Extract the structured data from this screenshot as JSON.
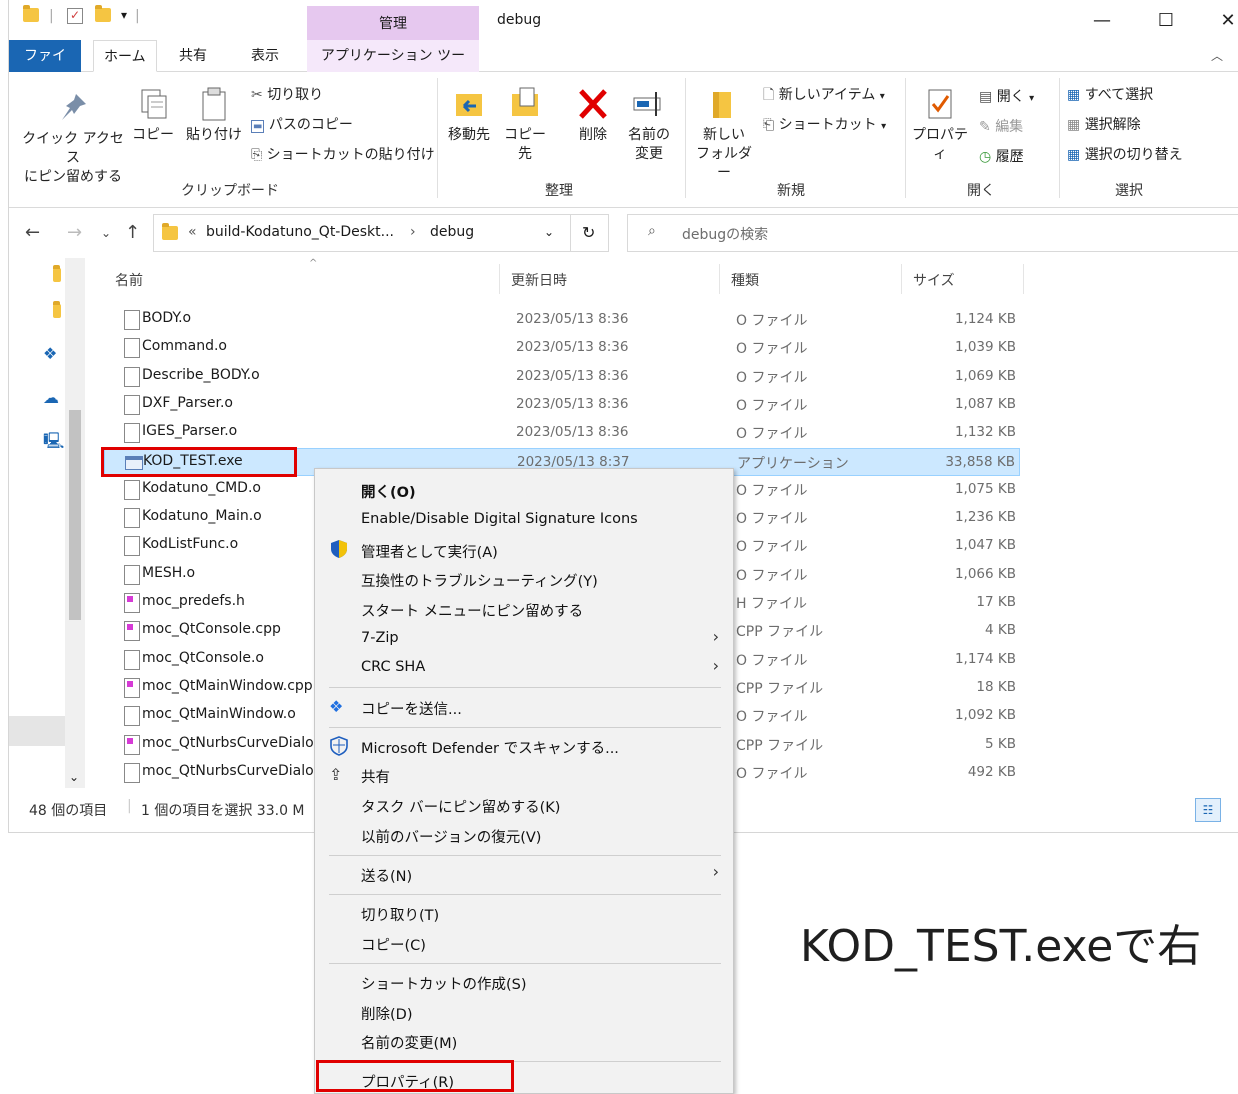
{
  "window": {
    "title": "debug",
    "context_tab_header": "管理",
    "controls": {
      "minimize": "—",
      "maximize": "☐",
      "close": "✕"
    }
  },
  "tabs": {
    "file": "ファイル",
    "home": "ホーム",
    "share": "共有",
    "view": "表示",
    "app_tools": "アプリケーション ツール"
  },
  "ribbon": {
    "clipboard": {
      "label": "クリップボード",
      "pin_line1": "クイック アクセス",
      "pin_line2": "にピン留めする",
      "copy": "コピー",
      "paste": "貼り付け",
      "cut": "切り取り",
      "copy_path": "パスのコピー",
      "paste_shortcut": "ショートカットの貼り付け"
    },
    "organize": {
      "label": "整理",
      "move_to": "移動先",
      "copy_to": "コピー先",
      "delete": "削除",
      "rename_line1": "名前の",
      "rename_line2": "変更"
    },
    "new": {
      "label": "新規",
      "new_folder_line1": "新しい",
      "new_folder_line2": "フォルダー",
      "new_item": "新しいアイテム",
      "shortcut": "ショートカット"
    },
    "open": {
      "label": "開く",
      "properties": "プロパティ",
      "open": "開く",
      "edit": "編集",
      "history": "履歴"
    },
    "select": {
      "label": "選択",
      "select_all": "すべて選択",
      "select_none": "選択解除",
      "invert": "選択の切り替え"
    }
  },
  "address": {
    "path_prefix": "«",
    "crumb1": "build-Kodatuno_Qt-Deskt...",
    "crumb2": "debug",
    "search_placeholder": "debugの検索"
  },
  "columns": {
    "name": "名前",
    "date": "更新日時",
    "type": "種類",
    "size": "サイズ"
  },
  "files": [
    {
      "name": "BODY.o",
      "date": "2023/05/13 8:36",
      "type": "O ファイル",
      "size": "1,124 KB"
    },
    {
      "name": "Command.o",
      "date": "2023/05/13 8:36",
      "type": "O ファイル",
      "size": "1,039 KB"
    },
    {
      "name": "Describe_BODY.o",
      "date": "2023/05/13 8:36",
      "type": "O ファイル",
      "size": "1,069 KB"
    },
    {
      "name": "DXF_Parser.o",
      "date": "2023/05/13 8:36",
      "type": "O ファイル",
      "size": "1,087 KB"
    },
    {
      "name": "IGES_Parser.o",
      "date": "2023/05/13 8:36",
      "type": "O ファイル",
      "size": "1,132 KB"
    },
    {
      "name": "KOD_TEST.exe",
      "date": "2023/05/13 8:37",
      "type": "アプリケーション",
      "size": "33,858 KB"
    },
    {
      "name": "Kodatuno_CMD.o",
      "date": "",
      "type": "O ファイル",
      "size": "1,075 KB"
    },
    {
      "name": "Kodatuno_Main.o",
      "date": "",
      "type": "O ファイル",
      "size": "1,236 KB"
    },
    {
      "name": "KodListFunc.o",
      "date": "",
      "type": "O ファイル",
      "size": "1,047 KB"
    },
    {
      "name": "MESH.o",
      "date": "",
      "type": "O ファイル",
      "size": "1,066 KB"
    },
    {
      "name": "moc_predefs.h",
      "date": "",
      "type": "H ファイル",
      "size": "17 KB"
    },
    {
      "name": "moc_QtConsole.cpp",
      "date": "",
      "type": "CPP ファイル",
      "size": "4 KB"
    },
    {
      "name": "moc_QtConsole.o",
      "date": "",
      "type": "O ファイル",
      "size": "1,174 KB"
    },
    {
      "name": "moc_QtMainWindow.cpp",
      "date": "",
      "type": "CPP ファイル",
      "size": "18 KB"
    },
    {
      "name": "moc_QtMainWindow.o",
      "date": "",
      "type": "O ファイル",
      "size": "1,092 KB"
    },
    {
      "name": "moc_QtNurbsCurveDialog.cpp",
      "date": "",
      "type": "CPP ファイル",
      "size": "5 KB"
    },
    {
      "name": "moc_QtNurbsCurveDialog.o",
      "date": "",
      "type": "O ファイル",
      "size": "492 KB"
    }
  ],
  "status": {
    "count": "48 個の項目",
    "selected": "1 個の項目を選択  33.0 M"
  },
  "context_menu": {
    "open": "開く(O)",
    "sig_icons": "Enable/Disable Digital Signature Icons",
    "run_as_admin": "管理者として実行(A)",
    "troubleshoot": "互換性のトラブルシューティング(Y)",
    "pin_start": "スタート メニューにピン留めする",
    "sevenzip": "7-Zip",
    "crc_sha": "CRC SHA",
    "dropbox_send": "コピーを送信...",
    "defender": "Microsoft Defender でスキャンする...",
    "share": "共有",
    "pin_taskbar": "タスク バーにピン留めする(K)",
    "restore_prev": "以前のバージョンの復元(V)",
    "send_to": "送る(N)",
    "cut": "切り取り(T)",
    "copy": "コピー(C)",
    "create_shortcut": "ショートカットの作成(S)",
    "delete": "削除(D)",
    "rename": "名前の変更(M)",
    "properties": "プロパティ(R)"
  },
  "caption": "KOD_TEST.exeで右",
  "colors": {
    "accent": "#1a66b3",
    "selection": "#cce8ff",
    "highlight_red": "#e00000",
    "context_tab": "#e6c8ef"
  }
}
